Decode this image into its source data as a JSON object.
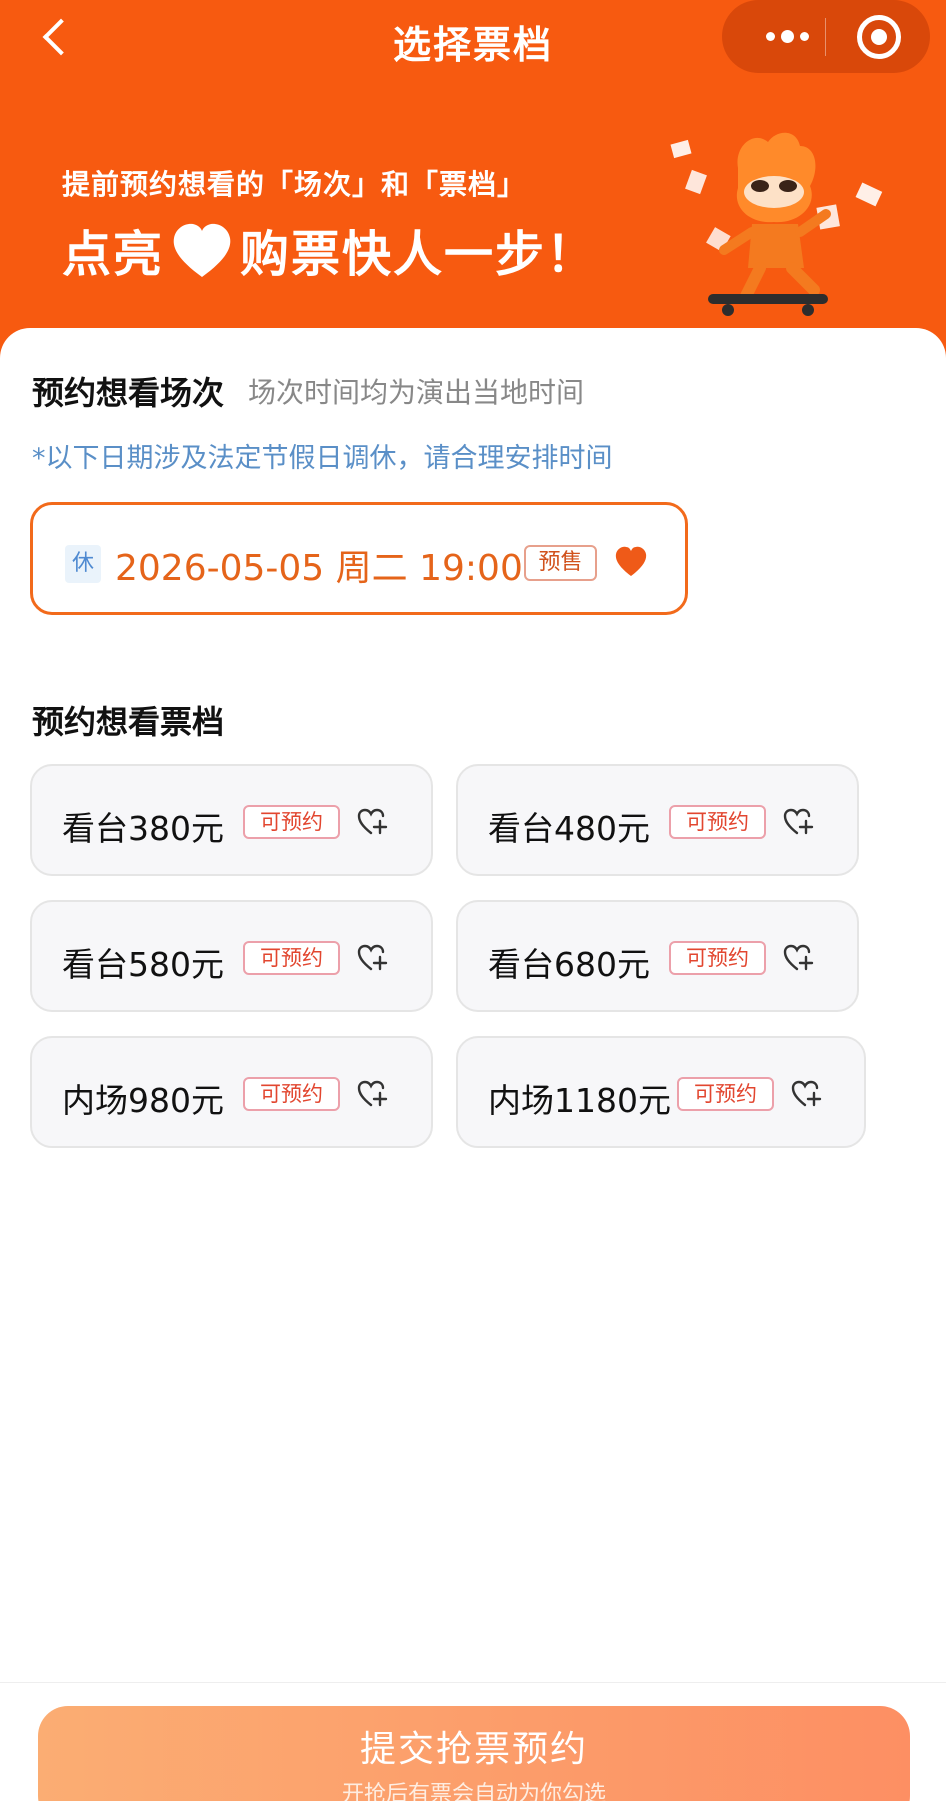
{
  "nav": {
    "title": "选择票档"
  },
  "promo": {
    "line1": "提前预约想看的「场次」和「票档」",
    "line2_pre": "点亮",
    "line2_post": "购票快人一步！"
  },
  "session_section": {
    "title": "预约想看场次",
    "subtitle": "场次时间均为演出当地时间",
    "notice": "*以下日期涉及法定节假日调休，请合理安排时间",
    "session": {
      "rest_tag": "休",
      "datetime": "2026-05-05 周二 19:00",
      "status": "预售",
      "selected": true
    }
  },
  "tier_section": {
    "title": "预约想看票档",
    "tiers": [
      {
        "name": "看台380元",
        "tag": "可预约"
      },
      {
        "name": "看台480元",
        "tag": "可预约"
      },
      {
        "name": "看台580元",
        "tag": "可预约"
      },
      {
        "name": "看台680元",
        "tag": "可预约"
      },
      {
        "name": "内场980元",
        "tag": "可预约"
      },
      {
        "name": "内场1180元",
        "tag": "可预约"
      }
    ]
  },
  "submit": {
    "label": "提交抢票预约",
    "sub": "开抢后有票会自动为你勾选"
  },
  "colors": {
    "brand": "#f75a10",
    "accent": "#e5641a",
    "notice": "#5a8fc7"
  },
  "icons": {
    "back": "chevron-left-icon",
    "more": "more-dots-icon",
    "close": "mini-program-close-icon",
    "heart": "heart-icon",
    "heart_add": "heart-plus-icon"
  }
}
